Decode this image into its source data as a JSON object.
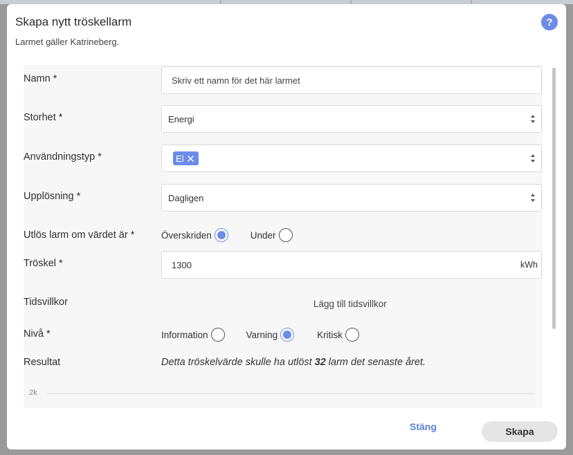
{
  "dialog": {
    "title": "Skapa nytt tröskellarm",
    "subtitle": "Larmet gäller Katrineberg.",
    "help_icon": "?"
  },
  "form": {
    "name": {
      "label": "Namn *",
      "placeholder": "Skriv ett namn för det här larmet",
      "value": ""
    },
    "quantity": {
      "label": "Storhet *",
      "selected": "Energi"
    },
    "usage_type": {
      "label": "Användningstyp *",
      "tags": [
        "El"
      ]
    },
    "resolution": {
      "label": "Upplösning *",
      "selected": "Dagligen"
    },
    "trigger": {
      "label": "Utlös larm om värdet är *",
      "options": [
        {
          "label": "Överskriden",
          "checked": true
        },
        {
          "label": "Under",
          "checked": false
        }
      ]
    },
    "threshold": {
      "label": "Tröskel *",
      "value": "1300",
      "unit": "kWh"
    },
    "time_conditions": {
      "label": "Tidsvillkor",
      "add_link": "Lägg till tidsvillkor"
    },
    "level": {
      "label": "Nivå *",
      "options": [
        {
          "label": "Information",
          "checked": false
        },
        {
          "label": "Varning",
          "checked": true
        },
        {
          "label": "Kritisk",
          "checked": false
        }
      ]
    },
    "result": {
      "label": "Resultat",
      "text_before": "Detta tröskelvärde skulle ha utlöst ",
      "count": "32",
      "text_after": " larm det senaste året."
    }
  },
  "chart_data": {
    "type": "bar",
    "y_ticks": [
      "2k"
    ],
    "categories": [],
    "values": []
  },
  "footer": {
    "close_label": "Stäng",
    "create_label": "Skapa"
  },
  "colors": {
    "accent": "#6c8ce8",
    "link": "#5b7fd8",
    "create_button_bg": "#e5e5e5"
  }
}
